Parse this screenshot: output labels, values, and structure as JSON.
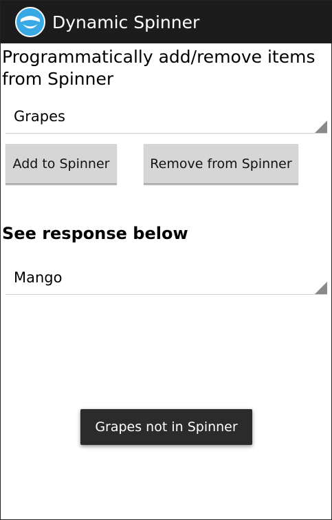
{
  "action_bar": {
    "title": "Dynamic Spinner",
    "icon": "app-face-icon",
    "background": "#1c1c1c",
    "icon_color": "#39a9e6"
  },
  "main": {
    "heading": "Programmatically add/remove items from Spinner",
    "spinner_top": {
      "selected": "Grapes"
    },
    "add_button_label": "Add to Spinner",
    "remove_button_label": "Remove from Spinner",
    "response_heading": "See response below",
    "spinner_bottom": {
      "selected": "Mango"
    }
  },
  "toast": {
    "message": "Grapes not in Spinner"
  }
}
